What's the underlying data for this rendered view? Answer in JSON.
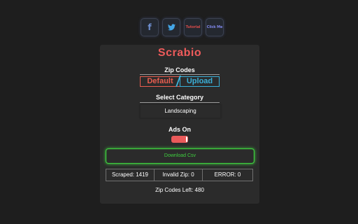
{
  "social": {
    "facebook_icon": "f",
    "twitter_icon": "🐦",
    "tutorial_label": "Tutorial",
    "click_me_label": "Click Me"
  },
  "app": {
    "title": "Scrabio"
  },
  "zip_section": {
    "label": "Zip Codes",
    "default_label": "Default",
    "upload_label": "Upload"
  },
  "category_section": {
    "label": "Select Category",
    "selected": "Landscaping"
  },
  "ads": {
    "label": "Ads On",
    "enabled": true
  },
  "download": {
    "label": "Download Csv"
  },
  "stats": {
    "scraped": "Scraped: 1419",
    "invalid_zip": "Invalid Zip: 0",
    "error": "ERROR: 0"
  },
  "zip_codes_left": "Zip Codes Left: 480",
  "colors": {
    "accent_red": "#ef5b5b",
    "accent_blue": "#3ab0d8",
    "accent_green": "#3fcf3f",
    "panel_bg": "#2b2b2b",
    "page_bg": "#1e1e1e"
  }
}
